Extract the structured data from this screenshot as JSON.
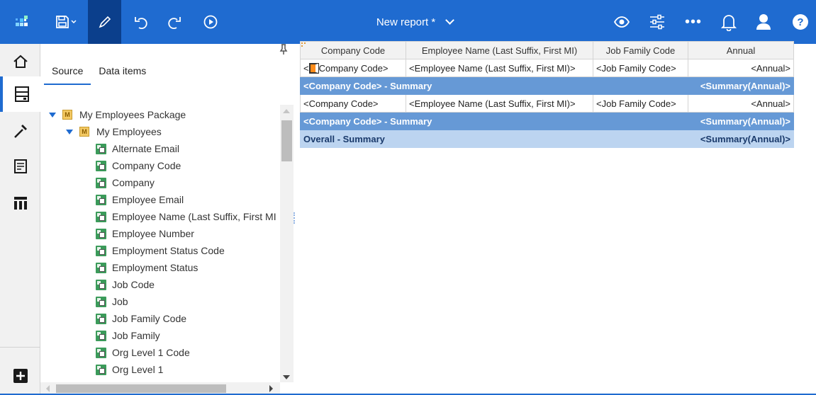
{
  "header": {
    "title": "New report *",
    "icons": [
      "app-logo-icon",
      "save-icon",
      "edit-icon",
      "undo-icon",
      "redo-icon",
      "run-icon",
      "preview-icon",
      "properties-icon",
      "more-icon",
      "notification-icon",
      "user-icon",
      "help-icon"
    ],
    "help_label": "?",
    "more_label": "•••"
  },
  "rail": {
    "items": [
      "home",
      "data",
      "toolbox",
      "pages",
      "queries"
    ],
    "active": "data",
    "add_label": "+"
  },
  "source_panel": {
    "tabs": [
      {
        "label": "Source",
        "active": true
      },
      {
        "label": "Data items",
        "active": false
      }
    ],
    "package": "My Employees Package",
    "folder": "My Employees",
    "items": [
      "Alternate Email",
      "Company Code",
      "Company",
      "Employee Email",
      "Employee Name (Last Suffix, First MI",
      "Employee Number",
      "Employment Status Code",
      "Employment Status",
      "Job Code",
      "Job",
      "Job Family Code",
      "Job Family",
      "Org Level 1 Code",
      "Org Level 1"
    ]
  },
  "report": {
    "columns": [
      "Company Code",
      "Employee Name (Last Suffix, First MI)",
      "Job Family Code",
      "Annual"
    ],
    "detail1": {
      "company_pre": "<",
      "company_post": "Company Code>",
      "name": "<Employee Name (Last Suffix, First MI)>",
      "job": "<Job Family Code>",
      "annual": "<Annual>"
    },
    "group1": {
      "label": "<Company Code>  -  Summary",
      "value": "<Summary(Annual)>"
    },
    "detail2": {
      "company": "<Company Code>",
      "name": "<Employee Name (Last Suffix, First MI)>",
      "job": "<Job Family Code>",
      "annual": "<Annual>"
    },
    "group2": {
      "label": "<Company Code>  -  Summary",
      "value": "<Summary(Annual)>"
    },
    "overall": {
      "label": "Overall  -  Summary",
      "value": "<Summary(Annual)>"
    }
  }
}
